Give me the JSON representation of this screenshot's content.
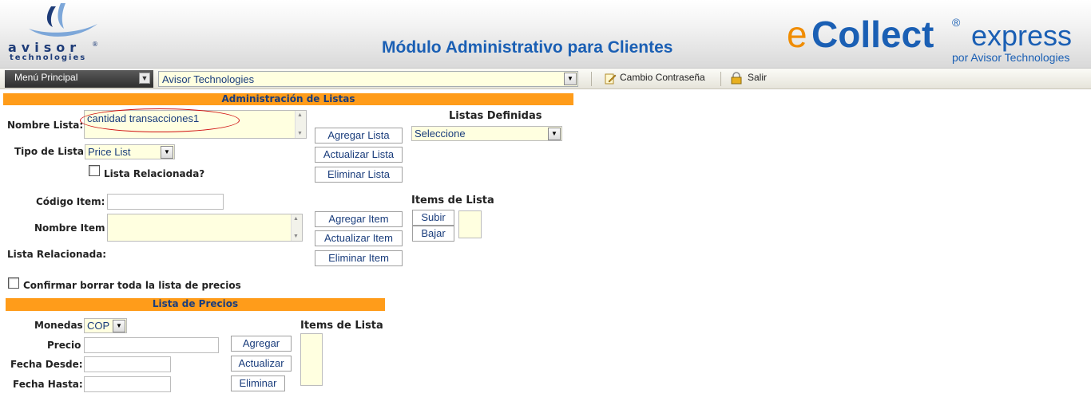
{
  "header": {
    "logo_word": "avisor",
    "logo_registered": "®",
    "logo_sub": "technologies",
    "title": "Módulo Administrativo para Clientes",
    "brand_e": "e",
    "brand_collect": "Collect",
    "brand_reg": "®",
    "brand_express": "express",
    "brand_by": "por Avisor Technologies"
  },
  "toolbar": {
    "menu_label": "Menú Principal",
    "company_value": "Avisor Technologies",
    "change_password": "Cambio Contraseña",
    "logout": "Salir"
  },
  "lists_admin": {
    "section_title": "Administración de Listas",
    "list_name_label": "Nombre Lista:",
    "list_name_value": "cantidad transacciones1",
    "list_type_label": "Tipo de Lista",
    "list_type_value": "Price List",
    "related_label": "Lista Relacionada?",
    "add_list": "Agregar Lista",
    "update_list": "Actualizar Lista",
    "delete_list": "Eliminar Lista",
    "defined_lists_label": "Listas Definidas",
    "defined_lists_value": "Seleccione",
    "item_code_label": "Código Item:",
    "item_name_label": "Nombre Item",
    "related_list_label": "Lista Relacionada:",
    "add_item": "Agregar Item",
    "update_item": "Actualizar Item",
    "delete_item": "Eliminar Item",
    "list_items_label": "Items de Lista",
    "move_up": "Subir",
    "move_down": "Bajar",
    "confirm_delete_label": "Confirmar borrar toda la lista de precios"
  },
  "price_list": {
    "section_title": "Lista de Precios",
    "currency_label": "Monedas",
    "currency_value": "COP",
    "price_label": "Precio",
    "date_from_label": "Fecha Desde:",
    "date_to_label": "Fecha Hasta:",
    "add": "Agregar",
    "update": "Actualizar",
    "delete": "Eliminar",
    "list_items_label": "Items de Lista"
  },
  "colors": {
    "section_bar": "#ff9c1a",
    "input_highlight": "#ffffe0",
    "brand_blue": "#1a5fb4",
    "brand_orange": "#f08c00",
    "annotation": "#d01010"
  }
}
